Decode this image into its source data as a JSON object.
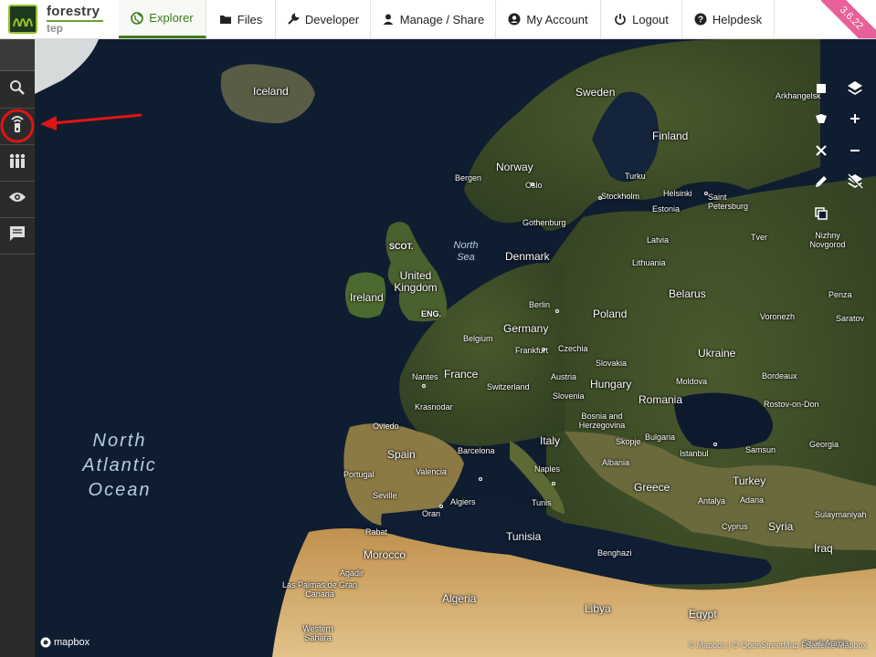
{
  "app": {
    "logo_title": "forestry",
    "logo_sub": "tep",
    "version": "3.6.22"
  },
  "nav": {
    "tabs": [
      {
        "label": "Explorer",
        "icon": "globe-icon",
        "active": true
      },
      {
        "label": "Files",
        "icon": "folder-icon"
      },
      {
        "label": "Developer",
        "icon": "wrench-icon"
      },
      {
        "label": "Manage / Share",
        "icon": "user-icon"
      },
      {
        "label": "My Account",
        "icon": "account-circle-icon"
      },
      {
        "label": "Logout",
        "icon": "power-icon"
      },
      {
        "label": "Helpdesk",
        "icon": "help-circle-icon"
      }
    ]
  },
  "sidebar": {
    "items": [
      {
        "name": "search",
        "icon": "search-icon"
      },
      {
        "name": "services",
        "icon": "satellite-dish-icon",
        "highlighted": true
      },
      {
        "name": "workspaces",
        "icon": "group-icon"
      },
      {
        "name": "view",
        "icon": "eye-icon"
      },
      {
        "name": "messages",
        "icon": "message-icon"
      }
    ]
  },
  "map": {
    "oceans": [
      "North",
      "Atlantic",
      "Ocean"
    ],
    "seas": [
      "North",
      "Sea"
    ],
    "countries": [
      "Iceland",
      "Sweden",
      "Finland",
      "Norway",
      "Denmark",
      "United Kingdom",
      "Ireland",
      "Belarus",
      "Poland",
      "Germany",
      "Ukraine",
      "Czechia",
      "Slovakia",
      "France",
      "Austria",
      "Hungary",
      "Moldova",
      "Switzerland",
      "Slovenia",
      "Romania",
      "Bosnia and Herzegovina",
      "Bulgaria",
      "Italy",
      "Spain",
      "Portugal",
      "Albania",
      "Greece",
      "Turkey",
      "Tunisia",
      "Morocco",
      "Algeria",
      "Libya",
      "Egypt",
      "Syria",
      "Iraq",
      "Cyprus",
      "Latvia",
      "Lithuania",
      "Estonia",
      "Georgia",
      "Western Sahara",
      "Saudi Arabia",
      "SCOT.",
      "ENG."
    ],
    "cities": [
      "Arkhangelsk",
      "Bergen",
      "Oslo",
      "Turku",
      "Helsinki",
      "Saint Petersburg",
      "Stockholm",
      "Gothenburg",
      "Tver",
      "Nizhny Novgorod",
      "Penza",
      "Saratov",
      "Voronezh",
      "Berlin",
      "Frankfurt",
      "Belgium",
      "Nantes",
      "Bordeaux",
      "Rostov-on-Don",
      "Krasnodar",
      "Oviedo",
      "Barcelona",
      "Valencia",
      "Seville",
      "Naples",
      "Skopje",
      "Istanbul",
      "Samsun",
      "Algiers",
      "Oran",
      "Tunis",
      "Antalya",
      "Adana",
      "Rabat",
      "Agadir",
      "Benghazi",
      "Las Palmas de Gran Canaria",
      "Sulaymaniyah"
    ],
    "attribution": "© Mapbox | © OpenStreetMap | Sattelite Mapbox",
    "mapbox": "mapbox"
  },
  "controls": [
    "square-icon",
    "layers-icon",
    "polygon-icon",
    "zoom-in-icon",
    "close-icon",
    "zoom-out-icon",
    "pencil-icon",
    "layers-clear-icon",
    "copy-icon"
  ],
  "colors": {
    "accent": "#3d7a1f",
    "ribbon": "#e8609a",
    "annotation": "#e01414"
  }
}
